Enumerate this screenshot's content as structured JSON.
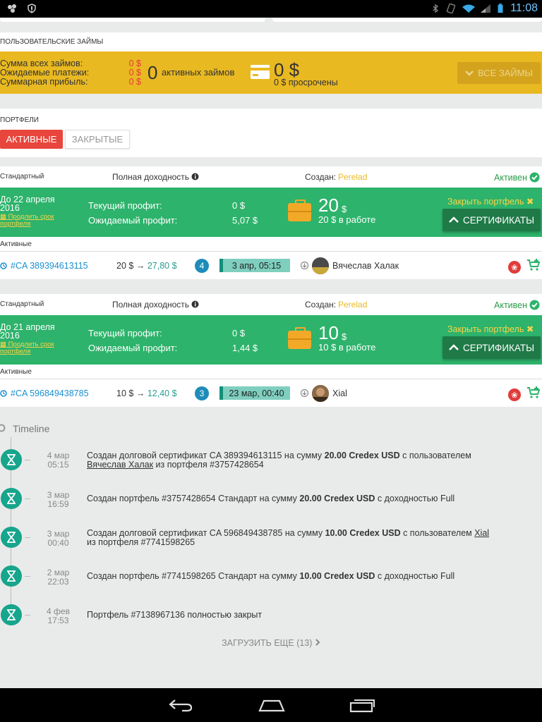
{
  "status_bar": {
    "time": "11:08"
  },
  "loans": {
    "section_label": "ПОЛЬЗОВАТЕЛЬСКИЕ ЗАЙМЫ",
    "rows": [
      {
        "label": "Сумма всех займов:",
        "value": "0 $"
      },
      {
        "label": "Ожидаемые платежи:",
        "value": "0 $"
      },
      {
        "label": "Суммарная прибыль:",
        "value": "0 $"
      }
    ],
    "active_count": "0",
    "active_label": "активных займов",
    "amount": "0 $",
    "overdue_label": "0 $ просрочены",
    "all_loans_button": "ВСЕ ЗАЙМЫ"
  },
  "portfolios": {
    "section_label": "ПОРТФЕЛИ",
    "tab_active": "АКТИВНЫЕ",
    "tab_closed": "ЗАКРЫТЫЕ",
    "items": [
      {
        "type": "Стандартный",
        "yield_label": "Полная доходность",
        "created_label": "Создан:",
        "created_by": "Perelad",
        "status": "Активен",
        "until_line1": "До 22 апреля",
        "until_line2": "2016",
        "extend_link": "Продлить срок портфеля",
        "current_profit_label": "Текущий профит:",
        "current_profit_value": "0 $",
        "expected_profit_label": "Ожидаемый профит:",
        "expected_profit_value": "5,07 $",
        "amount": "20",
        "amount_unit": "$",
        "in_work": "20 $ в работе",
        "close_link": "Закрыть портфель",
        "cert_button": "СЕРТИФИКАТЫ",
        "active_label": "Активные",
        "cert": {
          "id": "#CA 389394613115",
          "from": "20 $",
          "to": "27,80 $",
          "badge": "4",
          "date": "3 апр, 05:15",
          "user": "Вячеслав Халак"
        }
      },
      {
        "type": "Стандартный",
        "yield_label": "Полная доходность",
        "created_label": "Создан:",
        "created_by": "Perelad",
        "status": "Активен",
        "until_line1": "До 21 апреля",
        "until_line2": "2016",
        "extend_link": "Продлить срок портфеля",
        "current_profit_label": "Текущий профит:",
        "current_profit_value": "0 $",
        "expected_profit_label": "Ожидаемый профит:",
        "expected_profit_value": "1,44 $",
        "amount": "10",
        "amount_unit": "$",
        "in_work": "10 $ в работе",
        "close_link": "Закрыть портфель",
        "cert_button": "СЕРТИФИКАТЫ",
        "active_label": "Активные",
        "cert": {
          "id": "#CA 596849438785",
          "from": "10 $",
          "to": "12,40 $",
          "badge": "3",
          "date": "23 мар, 00:40",
          "user": "Xial"
        }
      }
    ]
  },
  "timeline": {
    "title": "Timeline",
    "events": [
      {
        "date": "4 мар",
        "time": "05:15",
        "t1": "Создан долговой сертификат CA 389394613115 на сумму ",
        "b1": "20.00 Credex USD",
        "t2": " с пользователем",
        "u": "Вячеслав Халак",
        "t3": " из портфеля #3757428654"
      },
      {
        "date": "3 мар",
        "time": "16:59",
        "t1": "Создан портфель #3757428654 Стандарт на сумму ",
        "b1": "20.00 Credex USD",
        "t2": " с доходностью Full"
      },
      {
        "date": "3 мар",
        "time": "00:40",
        "t1": "Создан долговой сертификат CA 596849438785 на сумму ",
        "b1": "10.00 Credex USD",
        "t2": " с пользователем ",
        "u": "Xial",
        "t3": "из портфеля #7741598265"
      },
      {
        "date": "2 мар",
        "time": "22:03",
        "t1": "Создан портфель #7741598265 Стандарт на сумму ",
        "b1": "10.00 Credex USD",
        "t2": " с доходностью Full"
      },
      {
        "date": "4 фев",
        "time": "17:53",
        "t1": "Портфель #7138967136 полностью закрыт"
      }
    ],
    "load_more": "ЗАГРУЗИТЬ ЕЩЕ (13)"
  }
}
